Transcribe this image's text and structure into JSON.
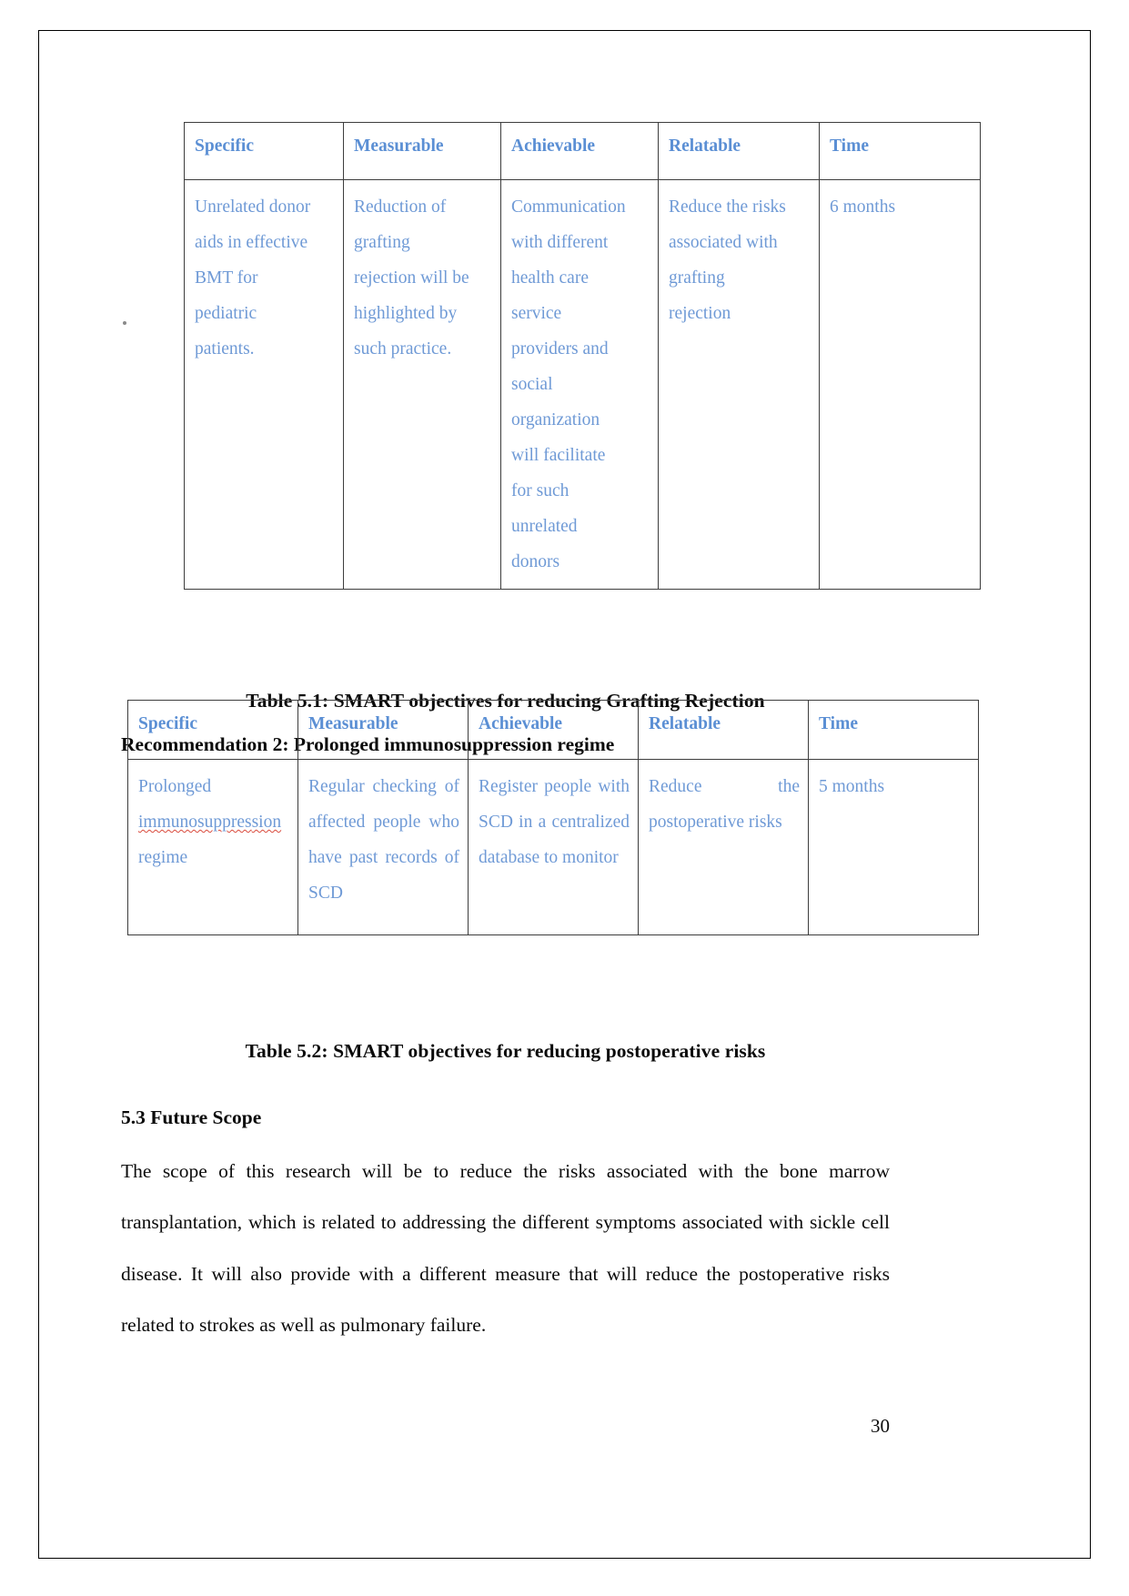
{
  "document": {
    "page_number": "30",
    "table1": {
      "headers": [
        "Specific",
        "Measurable",
        "Achievable",
        "Relatable",
        "Time"
      ],
      "row": {
        "specific": [
          "Unrelated donor",
          "aids in effective",
          "BMT for",
          "pediatric",
          "patients."
        ],
        "measurable": [
          "Reduction of",
          "grafting",
          "rejection will be",
          "highlighted by",
          "such practice."
        ],
        "achievable": [
          "Communication",
          "with different",
          "health care",
          "service",
          "providers and",
          "social",
          "organization",
          "will facilitate",
          "for such",
          "unrelated",
          "donors"
        ],
        "relatable": [
          "Reduce the risks",
          "associated with",
          "grafting",
          "rejection"
        ],
        "time": [
          "6 months"
        ]
      },
      "caption": "Table 5.1: SMART objectives for reducing Grafting Rejection"
    },
    "recommendation2_heading": "Recommendation 2: Prolonged immunosuppression regime",
    "table2": {
      "headers": [
        "Specific",
        "Measurable",
        "Achievable",
        "Relatable",
        "Time"
      ],
      "row": {
        "specific_line1": "Prolonged",
        "specific_misspelled_1": "immunosuppres",
        "specific_misspelled_2": "sion",
        "specific_line2_tail": " regime",
        "measurable": "Regular checking of affected people who have past records of SCD",
        "achievable": "Register people with SCD in a centralized database to monitor",
        "relatable": "Reduce the postoperative risks",
        "time": "5 months"
      },
      "caption": "Table 5.2: SMART objectives for reducing postoperative risks"
    },
    "section53": {
      "heading": "5.3 Future Scope",
      "paragraph": "The scope of this research will be to reduce the risks associated with the bone marrow transplantation, which is related to addressing the different symptoms associated with sickle cell disease. It will also provide with a different measure that will reduce the postoperative risks related to strokes as well as pulmonary failure."
    }
  },
  "colors": {
    "table_text": "#6f9ad6",
    "table_header_text": "#5b8fd4",
    "border": "#3d3d3d",
    "body_text": "#0b0b0b",
    "spellcheck_underline": "#d94a3c"
  }
}
